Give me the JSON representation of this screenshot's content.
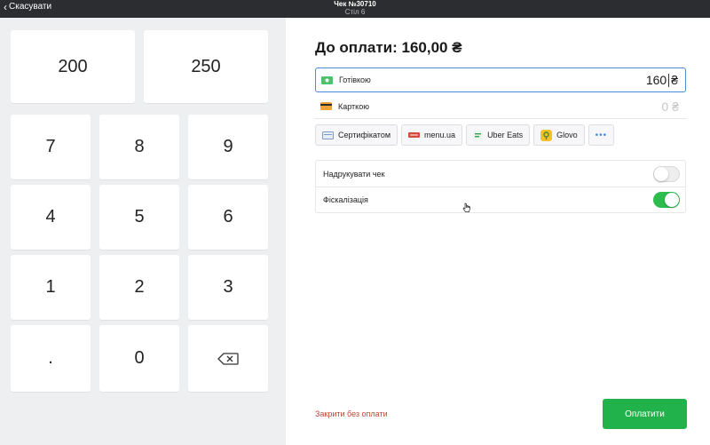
{
  "topbar": {
    "cancel_label": "Скасувати",
    "title": "Чек №30710",
    "subtitle": "Стіл 6"
  },
  "keypad": {
    "quick": [
      "200",
      "250"
    ],
    "keys": [
      "7",
      "8",
      "9",
      "4",
      "5",
      "6",
      "1",
      "2",
      "3",
      ".",
      "0"
    ],
    "backspace_icon": "backspace-icon"
  },
  "payment": {
    "due_label": "До оплати: 160,00 ₴",
    "cash": {
      "label": "Готівкою",
      "value": "160",
      "currency": "₴",
      "icon": "cash-icon"
    },
    "card": {
      "label": "Карткою",
      "value": "0",
      "currency": "₴",
      "icon": "card-icon"
    },
    "methods": [
      {
        "label": "Сертифікатом",
        "icon": "certificate-icon"
      },
      {
        "label": "menu.ua",
        "icon": "menu-ua-logo"
      },
      {
        "label": "Uber Eats",
        "icon": "uber-eats-icon"
      },
      {
        "label": "Glovo",
        "icon": "glovo-icon"
      }
    ],
    "more_label": "•••"
  },
  "options": {
    "print": {
      "label": "Надрукувати чек",
      "enabled": false
    },
    "fiscal": {
      "label": "Фіскалізація",
      "enabled": true
    }
  },
  "footer": {
    "close_label": "Закрити без оплати",
    "pay_label": "Оплатити"
  },
  "colors": {
    "accent_blue": "#4a8bd8",
    "pay_green": "#22b24c",
    "toggle_on": "#2dbd4e",
    "close_red": "#c2452f",
    "topbar": "#2c2d31",
    "keypad_bg": "#eeeff1"
  }
}
